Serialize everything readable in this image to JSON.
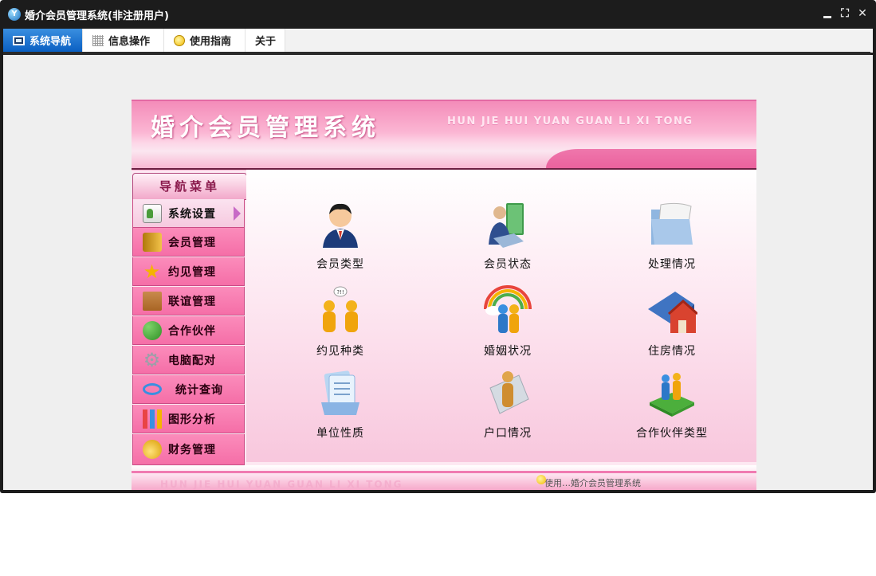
{
  "window": {
    "title": "婚介会员管理系统(非注册用户)",
    "controls": {
      "minimize": "",
      "restore": "⛶",
      "close": "✕"
    }
  },
  "menu": {
    "tabs": [
      {
        "label": "系统导航",
        "icon": "monitor-icon",
        "active": true
      },
      {
        "label": "信息操作",
        "icon": "grid-icon",
        "active": false
      },
      {
        "label": "使用指南",
        "icon": "bulb-icon",
        "active": false
      },
      {
        "label": "关于",
        "icon": "",
        "active": false
      }
    ]
  },
  "banner": {
    "title": "婚介会员管理系统",
    "subtitle": "HUN JIE HUI YUAN GUAN LI XI TONG"
  },
  "nav": {
    "header": "导航菜单",
    "items": [
      {
        "label": "系统设置",
        "icon": "id-card-icon",
        "active": true
      },
      {
        "label": "会员管理",
        "icon": "book-icon",
        "active": false
      },
      {
        "label": "约见管理",
        "icon": "star-icon",
        "active": false
      },
      {
        "label": "联谊管理",
        "icon": "box-icon",
        "active": false
      },
      {
        "label": "合作伙伴",
        "icon": "people-icon",
        "active": false
      },
      {
        "label": "电脑配对",
        "icon": "gear-icon",
        "active": false
      },
      {
        "label": "统计查询",
        "icon": "magnifier-icon",
        "active": false
      },
      {
        "label": "图形分析",
        "icon": "bar-chart-icon",
        "active": false
      },
      {
        "label": "财务管理",
        "icon": "coins-icon",
        "active": false
      }
    ]
  },
  "grid": {
    "items": [
      {
        "label": "会员类型",
        "icon": "businessman-icon"
      },
      {
        "label": "会员状态",
        "icon": "person-book-icon"
      },
      {
        "label": "处理情况",
        "icon": "folder-scroll-icon"
      },
      {
        "label": "约见种类",
        "icon": "meeting-people-icon"
      },
      {
        "label": "婚姻状况",
        "icon": "rainbow-couple-icon"
      },
      {
        "label": "住房情况",
        "icon": "house-book-icon"
      },
      {
        "label": "单位性质",
        "icon": "document-stack-icon"
      },
      {
        "label": "户口情况",
        "icon": "person-document-icon"
      },
      {
        "label": "合作伙伴类型",
        "icon": "partners-platform-icon"
      }
    ]
  },
  "footer": {
    "faded_text": "HUN JIE HUI YUAN GUAN LI XI TONG",
    "right_text": "使用…婚介会员管理系统"
  }
}
